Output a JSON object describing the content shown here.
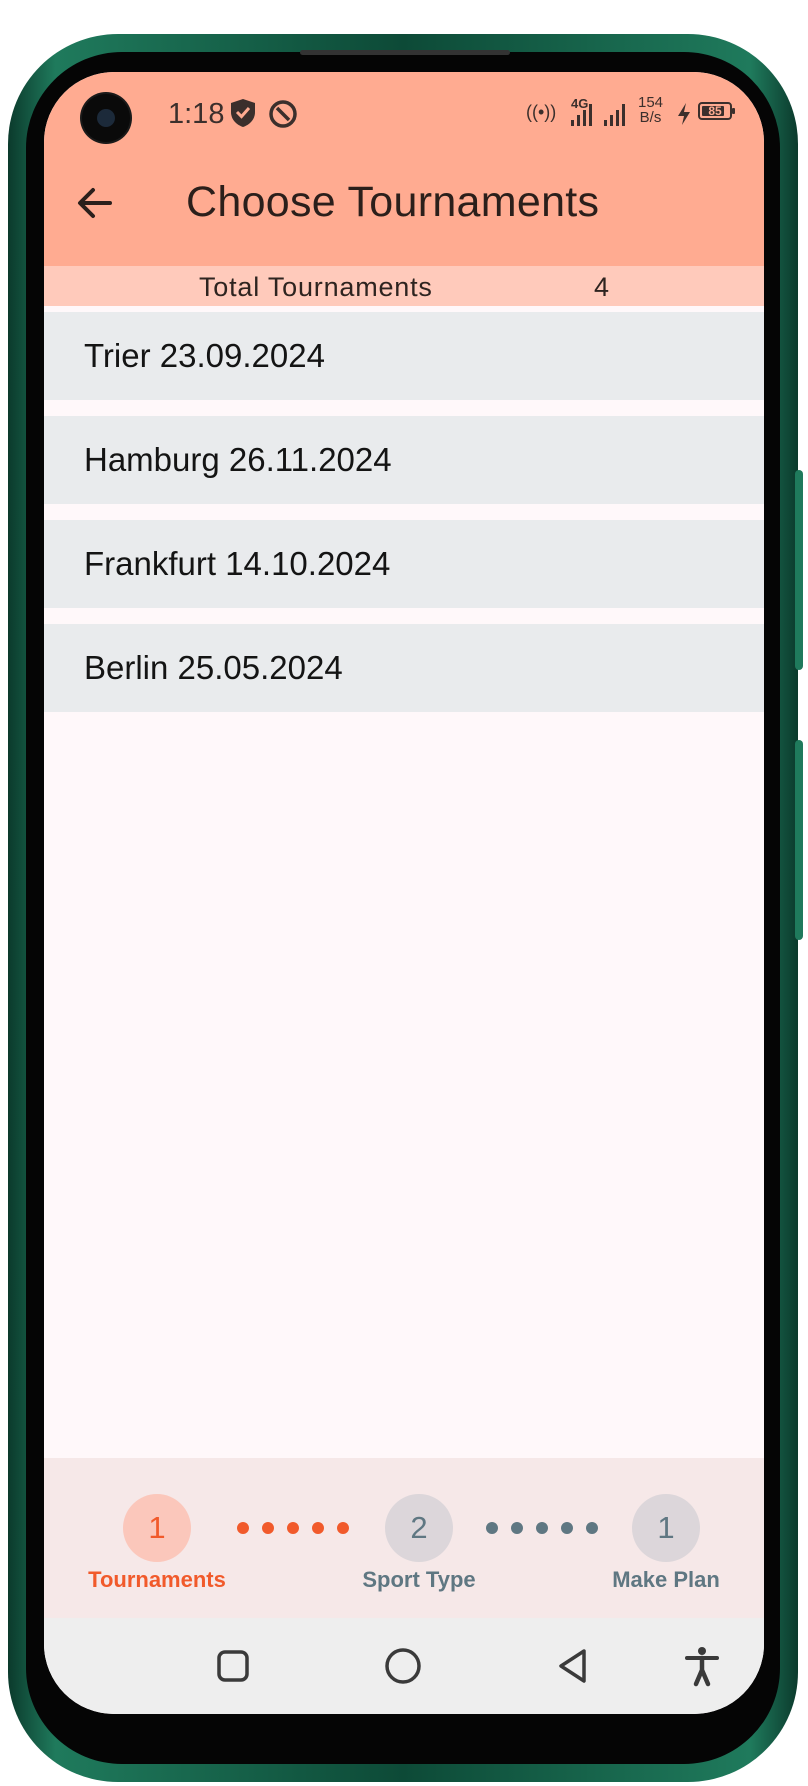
{
  "status_bar": {
    "time": "1:18",
    "network_type": "4G",
    "speed_value": "154",
    "speed_unit": "B/s",
    "battery_level": "85",
    "battery_fraction": 0.85,
    "icons": [
      "shield-icon",
      "sync-icon",
      "hotspot-icon",
      "signal-icon",
      "charging-bolt-icon",
      "battery-icon"
    ]
  },
  "app_bar": {
    "title": "Choose Tournaments",
    "back_icon": "arrow-left-icon"
  },
  "summary": {
    "label": "Total Tournaments",
    "value": "4"
  },
  "tournaments": [
    {
      "label": "Trier 23.09.2024"
    },
    {
      "label": "Hamburg 26.11.2024"
    },
    {
      "label": "Frankfurt 14.10.2024"
    },
    {
      "label": "Berlin 25.05.2024"
    }
  ],
  "stepper": {
    "steps": [
      {
        "number": "1",
        "label": "Tournaments",
        "state": "active"
      },
      {
        "number": "2",
        "label": "Sport Type",
        "state": "inactive"
      },
      {
        "number": "1",
        "label": "Make Plan",
        "state": "inactive"
      }
    ]
  },
  "nav_bar": {
    "buttons": [
      "recent-apps-icon",
      "home-icon",
      "back-triangle-icon",
      "accessibility-icon"
    ]
  },
  "colors": {
    "app_bar": "#ffab91",
    "summary_bar": "#ffcabb",
    "list_item": "#e9ebed",
    "accent": "#f15a2b",
    "inactive": "#5f7782",
    "stepper_bg": "#f6e8e8",
    "frame": "#1f7a5c"
  }
}
